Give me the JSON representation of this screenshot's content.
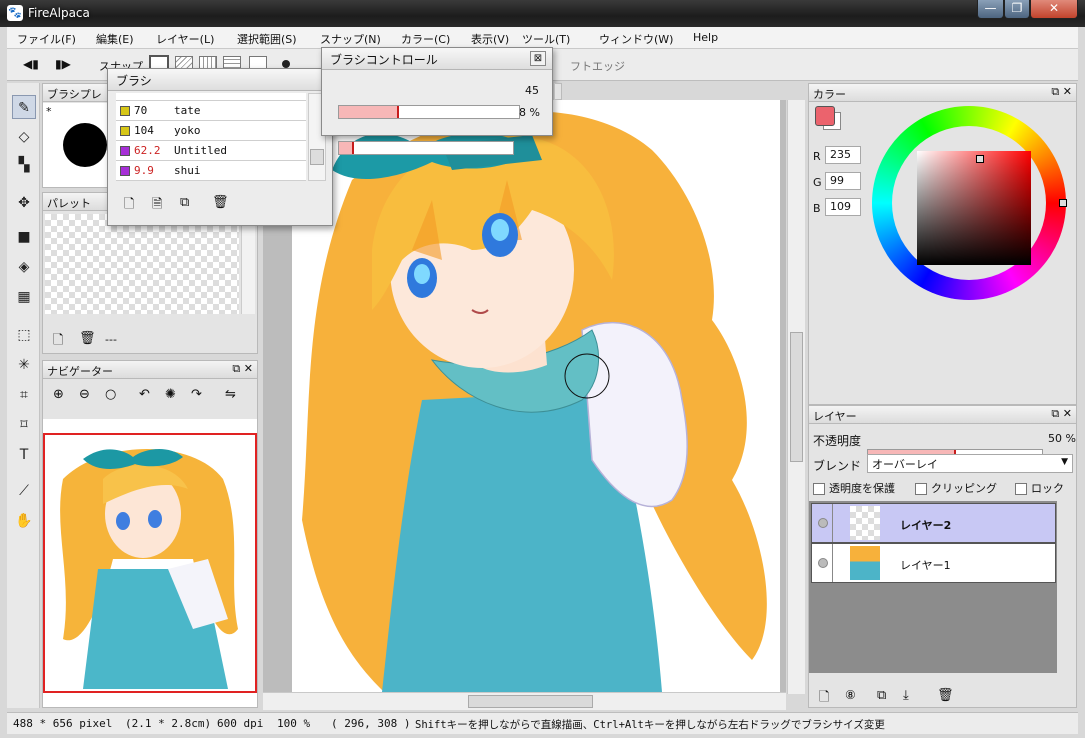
{
  "window": {
    "title": "FireAlpaca",
    "min": "—",
    "max": "❐",
    "close": "✕"
  },
  "menu": [
    "ファイル(F)",
    "編集(E)",
    "レイヤー(L)",
    "選択範囲(S)",
    "スナップ(N)",
    "カラー(C)",
    "表示(V)",
    "ツール(T)",
    "ウィンドウ(W)",
    "Help"
  ],
  "toolbar": {
    "snap_label": "スナップ",
    "edge_label": "フトエッジ"
  },
  "brush_panel": {
    "tab_label": "ブラシプレ",
    "preview_label": "*",
    "window_title": "ブラシ",
    "items": [
      {
        "size": "70",
        "name": "tate",
        "color": "#d6c617",
        "size_color": "#111111"
      },
      {
        "size": "104",
        "name": "yoko",
        "color": "#d6c617",
        "size_color": "#111111"
      },
      {
        "size": "62.2",
        "name": "Untitled",
        "color": "#a62fd6",
        "size_color": "#cc2222"
      },
      {
        "size": "9.9",
        "name": "shui",
        "color": "#a62fd6",
        "size_color": "#cc2222"
      }
    ]
  },
  "brush_control": {
    "title": "ブラシコントロール",
    "size_value": "45",
    "size_fraction": 0.33,
    "opacity_value": "8 %",
    "opacity_fraction": 0.08
  },
  "palette": {
    "title": "パレット",
    "name": "---"
  },
  "navigator": {
    "title": "ナビゲーター"
  },
  "color_panel": {
    "title": "カラー",
    "r_label": "R",
    "r": "235",
    "g_label": "G",
    "g": "99",
    "b_label": "B",
    "b": "109",
    "current_color": "#eb636d"
  },
  "layer_panel": {
    "title": "レイヤー",
    "opacity_label": "不透明度",
    "opacity_value": "50 %",
    "opacity_fraction": 0.5,
    "blend_label": "ブレンド",
    "blend_value": "オーバーレイ",
    "protect_alpha": "透明度を保護",
    "clipping": "クリッピング",
    "lock": "ロック",
    "layers": [
      {
        "name": "レイヤー2",
        "selected": true
      },
      {
        "name": "レイヤー1",
        "selected": false
      }
    ]
  },
  "status": {
    "size": "488 * 656 pixel",
    "cm": "(2.1 * 2.8cm)",
    "dpi": "600 dpi",
    "zoom": "100 %",
    "coords": "( 296, 308 )",
    "hint": "Shiftキーを押しながらで直線描画、Ctrl+Altキーを押しながら左右ドラッグでブラシサイズ変更"
  },
  "colors": {
    "accent": "#c71c1c",
    "layer_selected": "#c8c8f4"
  }
}
